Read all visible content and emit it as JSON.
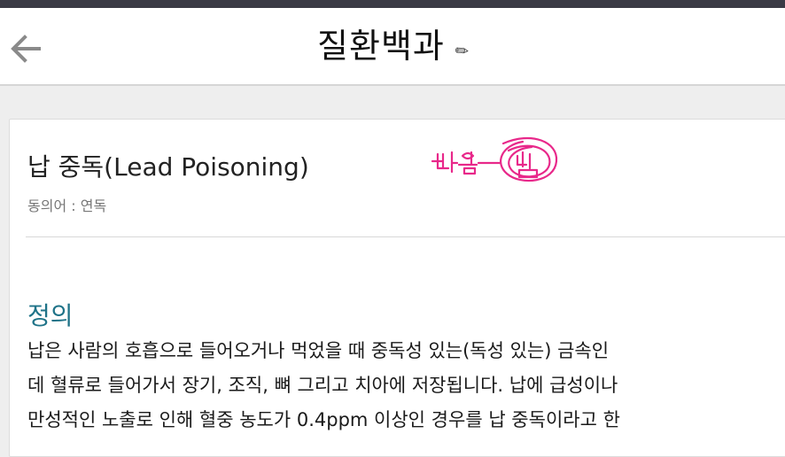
{
  "header": {
    "title": "질환백과",
    "edit_icon": "pencil-icon",
    "back_icon": "arrow-left-icon"
  },
  "article": {
    "title": "납 중독(Lead Poisoning)",
    "synonym": "동의어 : 연독",
    "section_heading": "정의",
    "body_lines": [
      "납은 사람의 호흡으로 들어오거나 먹었을 때 중독성 있는(독성 있는) 금속인",
      "데 혈류로 들어가서 장기, 조직, 뼈 그리고 치아에 저장됩니다. 납에 급성이나",
      "만성적인 노출로 인해 혈중 농도가 0.4ppm 이상인 경우를 납 중독이라고 한"
    ]
  },
  "handwritten_annotation": {
    "text": "번엳-납",
    "color": "#e8288a"
  },
  "colors": {
    "section_heading": "#1f7388",
    "top_bar": "#3a3a45",
    "annotation_ink": "#e8288a"
  }
}
